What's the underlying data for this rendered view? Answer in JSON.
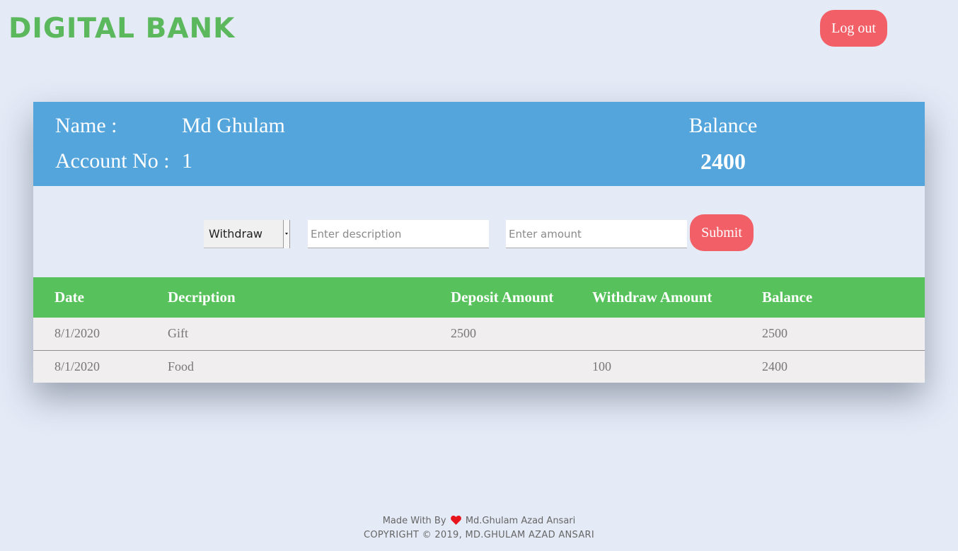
{
  "header": {
    "brand": "DIGITAL BANK",
    "logout_label": "Log out"
  },
  "account": {
    "name_label": "Name :",
    "name_value": "Md Ghulam",
    "account_no_label": "Account No :",
    "account_no_value": "1",
    "balance_label": "Balance",
    "balance_value": "2400"
  },
  "transaction_form": {
    "type_selected": "Withdraw",
    "description_placeholder": "Enter description",
    "amount_placeholder": "Enter amount",
    "submit_label": "Submit"
  },
  "transactions": {
    "columns": [
      "Date",
      "Decription",
      "Deposit Amount",
      "Withdraw Amount",
      "Balance"
    ],
    "rows": [
      {
        "date": "8/1/2020",
        "description": "Gift",
        "deposit": "2500",
        "withdraw": "",
        "balance": "2500"
      },
      {
        "date": "8/1/2020",
        "description": "Food",
        "deposit": "",
        "withdraw": "100",
        "balance": "2400"
      }
    ]
  },
  "footer": {
    "made_with_prefix": "Made With By",
    "heart_icon": "heart-icon",
    "heart_color": "#e8141c",
    "author": "Md.Ghulam Azad Ansari",
    "copyright": "COPYRIGHT © 2019, MD.GHULAM AZAD ANSARI"
  },
  "colors": {
    "brand": "#5cb85c",
    "accent_button": "#f25f67",
    "account_panel": "#55a5dd",
    "table_header": "#57c25b",
    "page_background": "#e4eaf6"
  }
}
